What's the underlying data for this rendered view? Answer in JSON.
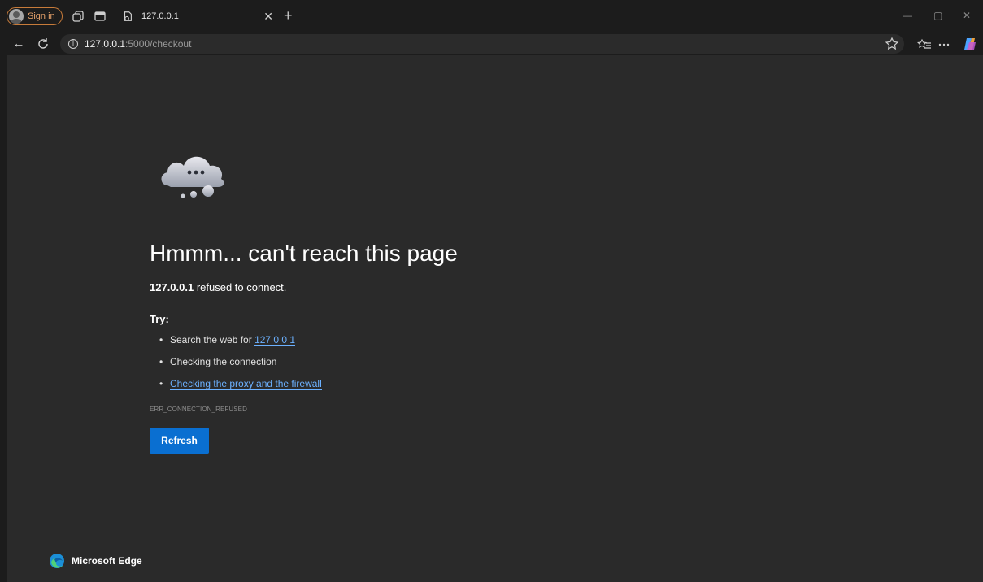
{
  "titlebar": {
    "signin_label": "Sign in",
    "tab_title": "127.0.0.1",
    "icons": [
      "collections-icon",
      "tab-actions-icon",
      "page-favicon-icon",
      "close-tab-icon",
      "new-tab-icon",
      "minimize-icon",
      "restore-icon",
      "close-window-icon"
    ]
  },
  "navbar": {
    "url_host": "127.0.0.1",
    "url_rest": ":5000/checkout",
    "icons": [
      "back-arrow-icon",
      "reload-icon",
      "site-info-icon",
      "favorite-star-icon",
      "favorites-icon",
      "more-icon",
      "copilot-icon"
    ]
  },
  "error": {
    "title": "Hmmm... can't reach this page",
    "host": "127.0.0.1",
    "subtitle_rest": " refused to connect.",
    "try_label": "Try:",
    "tip1_prefix": "Search the web for ",
    "tip1_link": "127 0 0 1",
    "tip2": "Checking the connection",
    "tip3_link": "Checking the proxy and the firewall",
    "code": "ERR_CONNECTION_REFUSED",
    "refresh_label": "Refresh"
  },
  "brand": {
    "name": "Microsoft Edge"
  },
  "colors": {
    "accent": "#0a6fd1",
    "link": "#6cb1ff",
    "background": "#2a2a2a",
    "chrome": "#1c1c1c"
  }
}
